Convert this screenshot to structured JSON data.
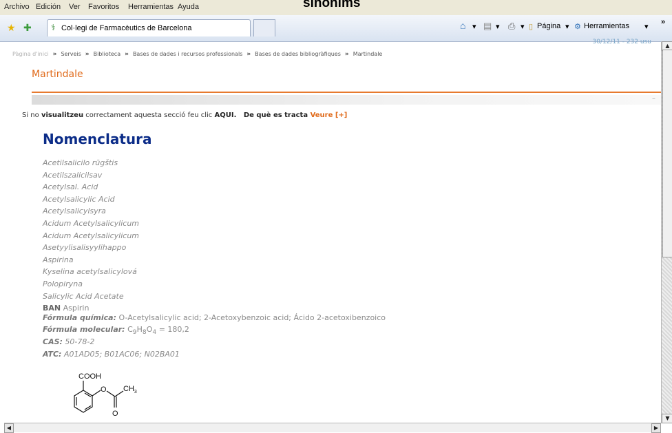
{
  "overlay_title": "sinonims",
  "menu": [
    "Archivo",
    "Edición",
    "Ver",
    "Favoritos",
    "Herramientas",
    "Ayuda"
  ],
  "tab": {
    "title": "Col·legi de Farmacèutics de Barcelona"
  },
  "toolbar_right": {
    "pagina": "Página",
    "herramientas": "Herramientas",
    "overflow": "»"
  },
  "timestamp": "30/12/11 - 232 usu",
  "breadcrumb": [
    "Pàgina d'inici",
    "Serveis",
    "Biblioteca",
    "Bases de dades i recursos professionals",
    "Bases de dades bibliogràfiques",
    "Martindale"
  ],
  "breadcrumb_sep": "»",
  "page_heading": "Martindale",
  "band_dash": "–",
  "notice": {
    "pre": "Si no ",
    "bold": "visualitzeu",
    "mid": " correctament aquesta secció feu clic ",
    "aqui": "AQUI.",
    "gap": "   De què es tracta ",
    "veure": "Veure [+]"
  },
  "section_title": "Nomenclatura",
  "synonyms": [
    "Acetilsalicilo rūgštis",
    "Acetilszalicilsav",
    "Acetylsal. Acid",
    "Acetylsalicylic Acid",
    "Acetylsalicylsyra",
    "Acidum Acetylsalicylicum",
    "Acidum Acetylsalicylicum",
    "Asetyylisalisyylihappo",
    "Aspirina",
    "Kyselina acetylsalicylová",
    "Polopiryna",
    "Salicylic Acid Acetate"
  ],
  "ban": {
    "label": "BAN",
    "value": "Aspirin"
  },
  "formula_quimica": {
    "label": "Fórmula química:",
    "value": "O-Acetylsalicylic acid; 2-Acetoxybenzoic acid; Ácido 2-acetoxibenzoico"
  },
  "formula_molecular": {
    "label": "Fórmula molecular:",
    "c": "C",
    "c_sub": "9",
    "h": "H",
    "h_sub": "8",
    "o": "O",
    "o_sub": "4",
    "rest": " = 180,2"
  },
  "cas": {
    "label": "CAS:",
    "value": "50-78-2"
  },
  "atc": {
    "label": "ATC:",
    "value": "A01AD05; B01AC06; N02BA01"
  },
  "structure_labels": {
    "cooh": "COOH",
    "o_ester": "O",
    "ch3": "CH",
    "ch3_sub": "3",
    "o_carbonyl": "O"
  }
}
